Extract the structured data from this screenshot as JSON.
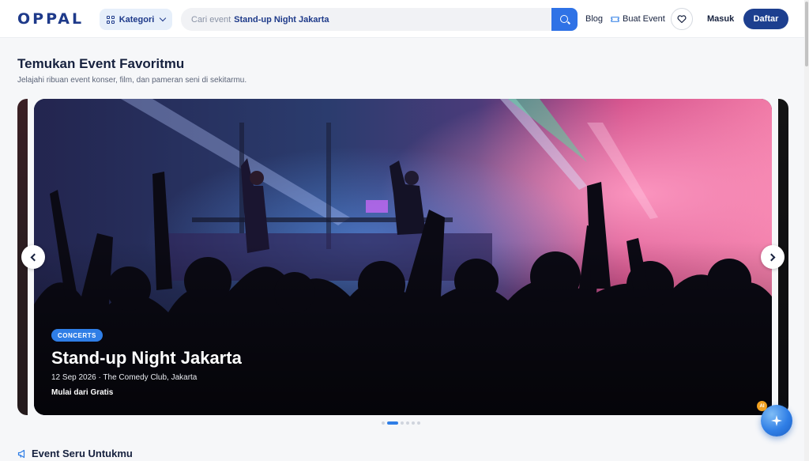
{
  "header": {
    "logo": "OPPAL",
    "kategori_label": "Kategori",
    "search_placeholder": "Cari event",
    "search_query": "Stand-up Night Jakarta",
    "blog_label": "Blog",
    "buat_event_label": "Buat Event",
    "masuk_label": "Masuk",
    "daftar_label": "Daftar"
  },
  "featured": {
    "title": "Temukan Event Favoritmu",
    "subtitle": "Jelajahi ribuan event konser, film, dan pameran seni di sekitarmu."
  },
  "carousel": {
    "slide": {
      "category": "CONCERTS",
      "title": "Stand-up Night Jakarta",
      "meta": "12 Sep 2026 · The Comedy Club, Jakarta",
      "price": "Mulai dari Gratis"
    },
    "total_slides": 6,
    "active_index": 1
  },
  "recommend": {
    "title": "Event Seru Untukmu"
  },
  "ai_badge": "AI",
  "colors": {
    "primary": "#1d3f8f",
    "accent": "#2f7ee6"
  },
  "icons": [
    "grid-icon",
    "chevron-down-icon",
    "search-icon",
    "ticket-icon",
    "heart-icon",
    "chevron-left-icon",
    "chevron-right-icon",
    "megaphone-icon",
    "sparkle-icon"
  ]
}
